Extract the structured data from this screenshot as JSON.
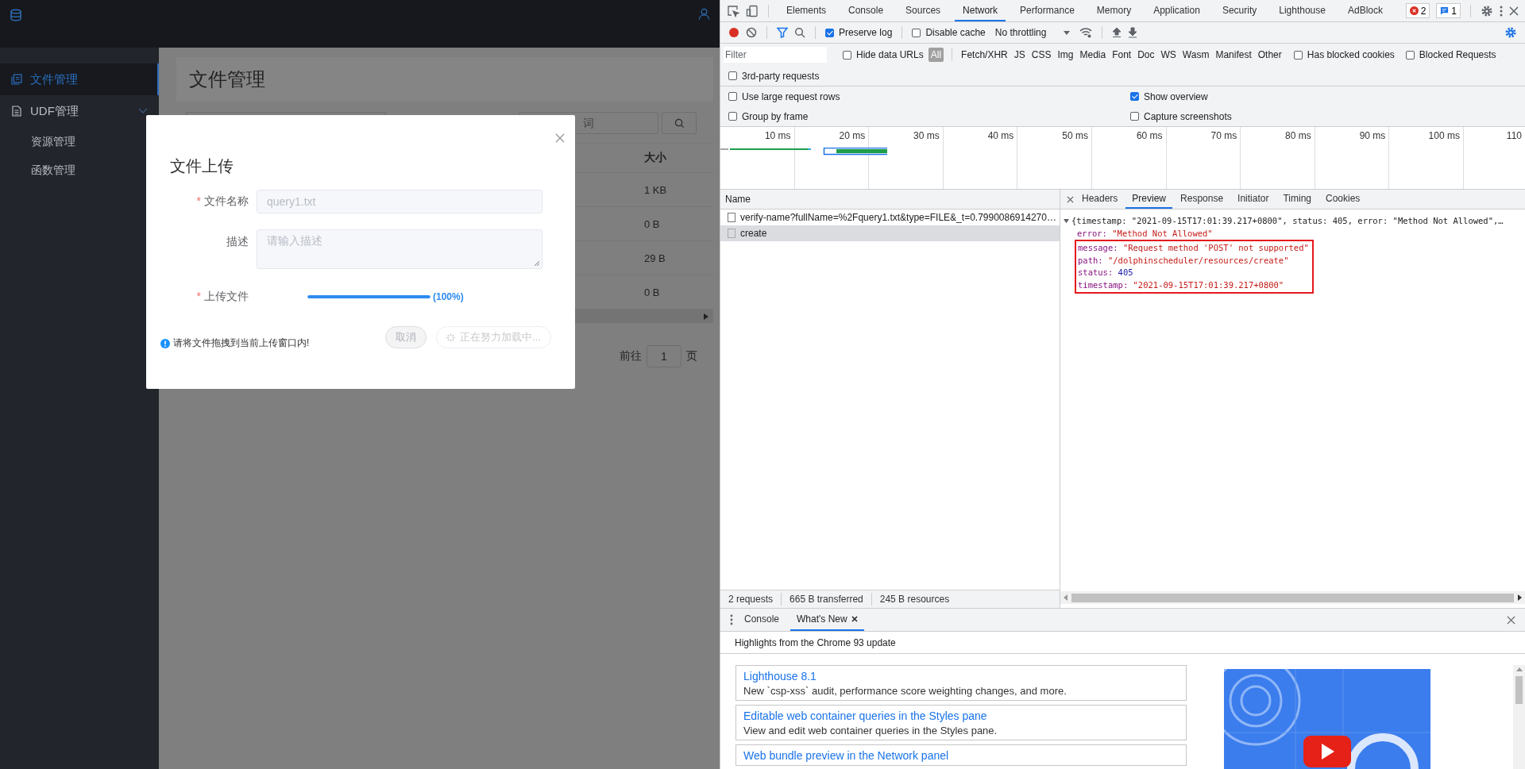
{
  "app": {
    "sidebar": {
      "items": [
        {
          "label": "文件管理",
          "selected": true
        },
        {
          "label": "UDF管理",
          "selected": false,
          "expanded": true,
          "children": [
            {
              "label": "资源管理",
              "selected": false
            },
            {
              "label": "函数管理",
              "selected": false
            }
          ]
        }
      ]
    },
    "page_title": "文件管理",
    "search": {
      "placeholder": "词"
    },
    "table": {
      "columns": [
        "大小"
      ],
      "rows": [
        [
          "1 KB"
        ],
        [
          "0 B"
        ],
        [
          "29 B"
        ],
        [
          "0 B"
        ]
      ]
    },
    "pagination": {
      "goto_label": "前往",
      "page": "1",
      "page_suffix": "页"
    },
    "dialog": {
      "title": "文件上传",
      "required_mark": "*",
      "fields": [
        {
          "kind": "input",
          "label": "文件名称",
          "required": true,
          "disabled": true,
          "value": "query1.txt"
        },
        {
          "kind": "textarea",
          "label": "描述",
          "required": false,
          "placeholder": "请输入描述"
        },
        {
          "kind": "progress",
          "label": "上传文件",
          "required": true,
          "level": 1,
          "reading": "(100%)"
        }
      ],
      "hint": "请将文件拖拽到当前上传窗口内!",
      "buttons": [
        {
          "label": "取消",
          "kind": "cancel",
          "disabled": true
        },
        {
          "label": "正在努力加载中...",
          "kind": "loading",
          "disabled": true
        }
      ]
    }
  },
  "devtools": {
    "tabs": [
      {
        "label": "Elements",
        "selected": false
      },
      {
        "label": "Console",
        "selected": false
      },
      {
        "label": "Sources",
        "selected": false
      },
      {
        "label": "Network",
        "selected": true
      },
      {
        "label": "Performance",
        "selected": false
      },
      {
        "label": "Memory",
        "selected": false
      },
      {
        "label": "Application",
        "selected": false
      },
      {
        "label": "Security",
        "selected": false
      },
      {
        "label": "Lighthouse",
        "selected": false
      },
      {
        "label": "AdBlock",
        "selected": false
      }
    ],
    "error_count": "2",
    "message_count": "1",
    "toolbar": {
      "preserve_log": {
        "label": "Preserve log",
        "checked": true
      },
      "disable_cache": {
        "label": "Disable cache",
        "checked": false
      },
      "throttling": "No throttling"
    },
    "filter": {
      "placeholder": "Filter",
      "hide_data_urls": {
        "label": "Hide data URLs",
        "checked": false
      },
      "types": [
        {
          "label": "All",
          "selected": true
        },
        {
          "label": "Fetch/XHR",
          "selected": false
        },
        {
          "label": "JS",
          "selected": false
        },
        {
          "label": "CSS",
          "selected": false
        },
        {
          "label": "Img",
          "selected": false
        },
        {
          "label": "Media",
          "selected": false
        },
        {
          "label": "Font",
          "selected": false
        },
        {
          "label": "Doc",
          "selected": false
        },
        {
          "label": "WS",
          "selected": false
        },
        {
          "label": "Wasm",
          "selected": false
        },
        {
          "label": "Manifest",
          "selected": false
        },
        {
          "label": "Other",
          "selected": false
        }
      ],
      "extra": [
        {
          "label": "Has blocked cookies",
          "checked": false
        },
        {
          "label": "Blocked Requests",
          "checked": false
        },
        {
          "label": "3rd-party requests",
          "checked": false
        }
      ]
    },
    "settings": [
      {
        "label": "Use large request rows",
        "checked": false
      },
      {
        "label": "Group by frame",
        "checked": false
      },
      {
        "label": "Show overview",
        "checked": true
      },
      {
        "label": "Capture screenshots",
        "checked": false
      }
    ],
    "overview_ticks": [
      "10 ms",
      "20 ms",
      "30 ms",
      "40 ms",
      "50 ms",
      "60 ms",
      "70 ms",
      "80 ms",
      "90 ms",
      "100 ms",
      "110"
    ],
    "requests": {
      "column": "Name",
      "rows": [
        {
          "name": "verify-name?fullName=%2Fquery1.txt&type=FILE&_t=0.7990086914270…",
          "selected": false
        },
        {
          "name": "create",
          "selected": true
        }
      ]
    },
    "summary": [
      "2 requests",
      "665 B transferred",
      "245 B resources"
    ],
    "detail_tabs": [
      {
        "label": "Headers",
        "selected": false
      },
      {
        "label": "Preview",
        "selected": true
      },
      {
        "label": "Response",
        "selected": false
      },
      {
        "label": "Initiator",
        "selected": false
      },
      {
        "label": "Timing",
        "selected": false
      },
      {
        "label": "Cookies",
        "selected": false
      }
    ],
    "preview": {
      "summary": "{timestamp: \"2021-09-15T17:01:39.217+0800\", status: 405, error: \"Method Not Allowed\",…",
      "expanded": true,
      "children": [
        {
          "key": "error:",
          "value": "\"Method Not Allowed\"",
          "kind": "string",
          "highlighted": false
        },
        {
          "key": "message:",
          "value": "\"Request method 'POST' not supported\"",
          "kind": "string",
          "highlighted": true
        },
        {
          "key": "path:",
          "value": "\"/dolphinscheduler/resources/create\"",
          "kind": "string",
          "highlighted": true
        },
        {
          "key": "status:",
          "value": "405",
          "kind": "number",
          "highlighted": true
        },
        {
          "key": "timestamp:",
          "value": "\"2021-09-15T17:01:39.217+0800\"",
          "kind": "string",
          "highlighted": true
        }
      ]
    },
    "drawer": {
      "tabs": [
        {
          "label": "Console",
          "selected": false,
          "closable": false
        },
        {
          "label": "What's New",
          "selected": true,
          "closable": true
        }
      ],
      "heading": "Highlights from the Chrome 93 update",
      "cards": [
        {
          "title": "Lighthouse 8.1",
          "text": "New `csp-xss` audit, performance score weighting changes, and more."
        },
        {
          "title": "Editable web container queries in the Styles pane",
          "text": "View and edit web container queries in the Styles pane."
        },
        {
          "title": "Web bundle preview in the Network panel"
        }
      ]
    }
  }
}
